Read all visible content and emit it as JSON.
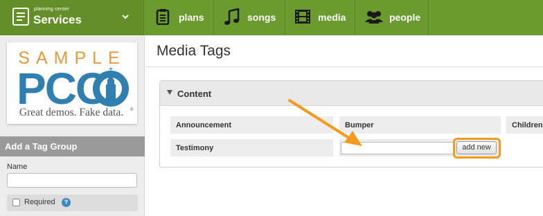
{
  "brand": {
    "small_label": "planning center",
    "product": "Services",
    "icon": "services-logo-icon",
    "dropdown_icon": "chevron-down-icon"
  },
  "nav": [
    {
      "label": "plans",
      "icon": "clipboard-icon"
    },
    {
      "label": "songs",
      "icon": "music-note-icon"
    },
    {
      "label": "media",
      "icon": "film-strip-icon"
    },
    {
      "label": "people",
      "icon": "people-icon"
    }
  ],
  "sidebar": {
    "logo": {
      "word1": "SAMPLE",
      "word2": "PCO",
      "tagline": "Great demos. Fake data.",
      "mark": "®"
    },
    "tag_group_header": "Add a Tag Group",
    "name_label": "Name",
    "name_value": "",
    "required_label": "Required",
    "help_label": "?"
  },
  "main": {
    "title": "Media Tags",
    "section": {
      "title": "Content",
      "tags": [
        "Announcement",
        "Bumper",
        "Children",
        "Testimony"
      ],
      "new_tag_value": "",
      "add_button": "add new"
    }
  },
  "colors": {
    "nav_green": "#6b9a2e",
    "pco_blue": "#2f7fb0",
    "pco_orange": "#e39a3a",
    "annotation_orange": "#f29b1d"
  }
}
